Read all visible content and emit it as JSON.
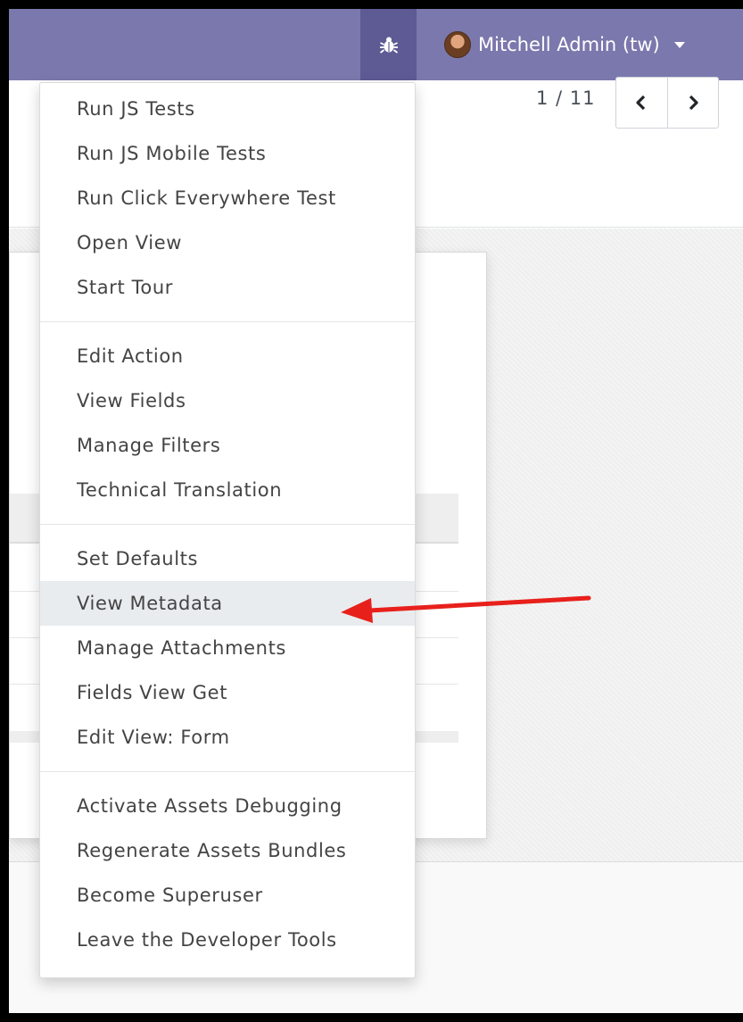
{
  "navbar": {
    "debug_icon": "bug-icon",
    "user_name": "Mitchell Admin (tw)",
    "avatar_icon": "user-avatar",
    "caret_icon": "caret-down-icon",
    "background_color": "#7b78ad",
    "debug_background_color": "#5d5a94"
  },
  "pager": {
    "value": "1 / 11",
    "prev_icon": "chevron-left-icon",
    "next_icon": "chevron-right-icon"
  },
  "debug_menu": {
    "groups": [
      [
        "Run JS Tests",
        "Run JS Mobile Tests",
        "Run Click Everywhere Test",
        "Open View",
        "Start Tour"
      ],
      [
        "Edit Action",
        "View Fields",
        "Manage Filters",
        "Technical Translation"
      ],
      [
        "Set Defaults",
        "View Metadata",
        "Manage Attachments",
        "Fields View Get",
        "Edit View: Form"
      ],
      [
        "Activate Assets Debugging",
        "Regenerate Assets Bundles",
        "Become Superuser",
        "Leave the Developer Tools"
      ]
    ],
    "highlighted_item": "View Metadata"
  },
  "annotation": {
    "arrow_icon": "red-arrow-annotation",
    "arrow_color": "#e8201b"
  }
}
